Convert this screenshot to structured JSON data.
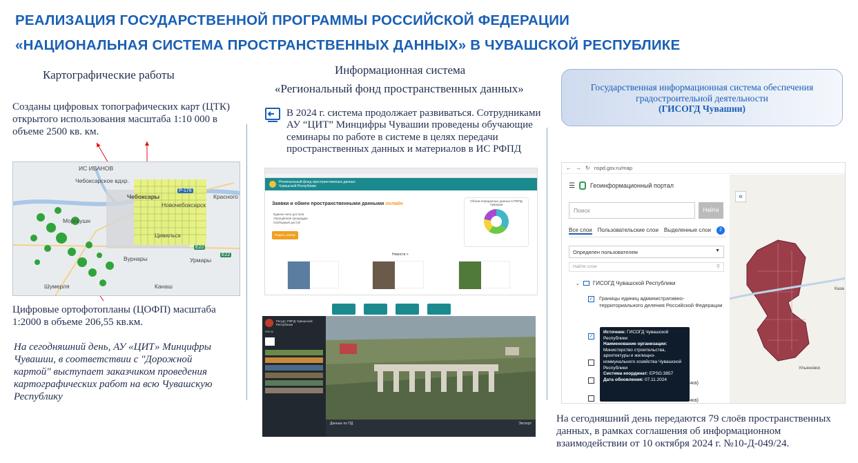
{
  "title": {
    "line1": "РЕАЛИЗАЦИЯ ГОСУДАРСТВЕННОЙ ПРОГРАММЫ РОССИЙСКОЙ ФЕДЕРАЦИИ",
    "line2": "«НАЦИОНАЛЬНАЯ СИСТЕМА ПРОСТРАНСТВЕННЫХ ДАННЫХ» В ЧУВАШСКОЙ РЕСПУБЛИКЕ"
  },
  "col1": {
    "heading": "Картографические работы",
    "text1": "Созданы цифровых топографических карт (ЦТК) открытого использования масштаба 1:10 000 в объеме  2500 кв. км.",
    "text2": "Цифровые ортофотопланы (ЦОФП) масштаба 1:2000 в объеме 206,55 кв.км.",
    "italic": "На сегодняшний день, АУ «ЦИТ» Минцифры Чувашии, в соответствии с \"Дорожной картой\" выступает заказчиком проведения картографических работ  на всю Чувашскую Республику",
    "map_labels": [
      "ИС ИВАНОВ",
      "Чебоксарское вдхр.",
      "Новочебоксарск",
      "Чебоксары",
      "Красного",
      "Моргаушн",
      "Цивильск",
      "Урмары",
      "Канаш",
      "Шумерля",
      "Вурнары"
    ],
    "map_roads": [
      "P-176",
      "E22",
      "E22"
    ]
  },
  "col2": {
    "heading1": "Информационная система",
    "heading2": "«Региональный фонд пространственных данных»",
    "text": "В 2024 г.  система продолжает развиваться. Сотрудниками АУ “ЦИТ” Минцифры Чувашии проведены обучающие семинары по работе в системе в целях передачи пространственных данных и материалов в ИС РФПД",
    "web": {
      "banner": "Региональный фонд пространственных данных Чувашской Республики",
      "requests_title": "Заявки и обмен пространственными данными",
      "requests_accent": "онлайн",
      "stats_title": "Объем переданных данных в РФПД Чувашии",
      "submit": "Подать заявку",
      "news": "Новости >",
      "options": [
        "Единое окно доступа",
        "Упрощённая процедура",
        "Свободный доступ"
      ]
    },
    "viewer": {
      "title": "Ресурс РФПД Чувашской Республики",
      "menu": "Меню",
      "toolbar": "Данные по ПД",
      "export": "Экспорт"
    }
  },
  "col3": {
    "gis_line1": "Государственная информационная система обеспечения",
    "gis_line2": "градостроительной деятельности",
    "gis_line3": "(ГИСОГД Чувашии)",
    "bottom": "На сегодняшний день  передаются 79 слоёв пространственных данных,  в рамках  соглашения об информационном взаимодействии от 10 октября 2024 г. №10-Д-049/24.",
    "portal": {
      "url": "nspd.gov.ru/map",
      "title": "Геоинформационный портал",
      "search_placeholder": "Поиск",
      "find_button": "Найти",
      "tabs": [
        "Все слои",
        "Пользовательские слои",
        "Выделенные слои"
      ],
      "selected_badge": "2",
      "filter": "Определен пользователем",
      "layer_search": "Найти слои",
      "group": "ГИСОГД Чувашской Республики",
      "layer1": "Границы единиц административно-территориального деления Российской Федерации",
      "tooltip_source_label": "Источник:",
      "tooltip_source": "ГИСОГД Чувашской Республики",
      "tooltip_org_label": "Наименование организации:",
      "tooltip_org": "Министерство строительства, архитектуры и жилищно-коммунального хозяйства Чувашской Республики",
      "tooltip_crs_label": "Система координат:",
      "tooltip_crs": "EPSG:3857",
      "tooltip_date_label": "Дата обновления:",
      "tooltip_date": "07.11.2024",
      "hidden1": "чка)",
      "hidden2": "чка)",
      "map_city1": "Ульяновск",
      "map_city2": "Каза"
    }
  },
  "colors": {
    "title": "#1a5fb4",
    "text": "#1f2d4d",
    "accent": "#f0a020",
    "teal": "#1b8a8f"
  }
}
